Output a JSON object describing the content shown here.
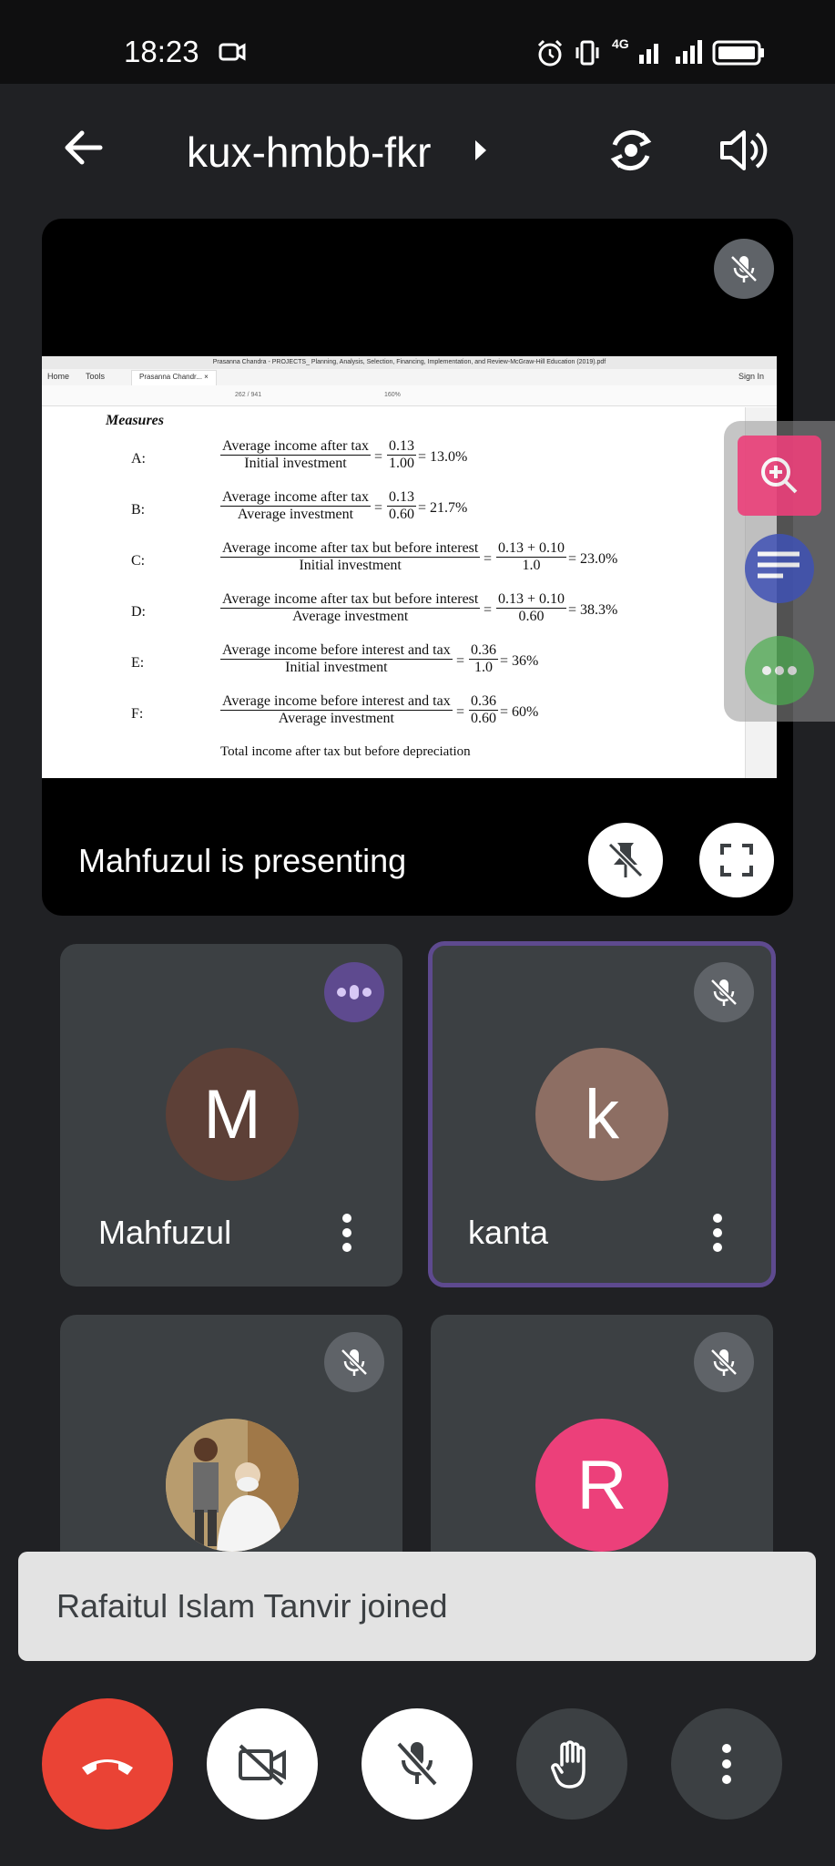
{
  "status_bar": {
    "time": "18:23",
    "network": "4G"
  },
  "header": {
    "meeting_code": "kux-hmbb-fkr",
    "back_icon": "arrow-left-icon",
    "switch_camera_icon": "camera-switch-icon",
    "audio_icon": "volume-icon"
  },
  "presentation": {
    "window_title": "Prasanna Chandra - PROJECTS_ Planning, Analysis, Selection, Financing, Implementation, and Review-McGraw-Hill Education (2019).pdf",
    "tabs": [
      "Home",
      "Tools",
      "Prasanna Chandr... ×"
    ],
    "sign_in": "Sign In",
    "page_indicator": "262 / 941",
    "zoom": "160%",
    "heading": "Measures",
    "rows": [
      {
        "letter": "A:",
        "num": "Average income after tax",
        "den": "Initial investment",
        "fnum": "0.13",
        "fden": "1.00",
        "result": "= 13.0%"
      },
      {
        "letter": "B:",
        "num": "Average income after tax",
        "den": "Average investment",
        "fnum": "0.13",
        "fden": "0.60",
        "result": "= 21.7%"
      },
      {
        "letter": "C:",
        "num": "Average income after tax but before interest",
        "den": "Initial investment",
        "fnum": "0.13 + 0.10",
        "fden": "1.0",
        "result": "= 23.0%"
      },
      {
        "letter": "D:",
        "num": "Average income after tax but before interest",
        "den": "Average investment",
        "fnum": "0.13 + 0.10",
        "fden": "0.60",
        "result": "= 38.3%"
      },
      {
        "letter": "E:",
        "num": "Average income before interest and tax",
        "den": "Initial investment",
        "fnum": "0.36",
        "fden": "1.0",
        "result": "= 36%"
      },
      {
        "letter": "F:",
        "num": "Average income before interest and tax",
        "den": "Average investment",
        "fnum": "0.36",
        "fden": "0.60",
        "result": "= 60%"
      }
    ],
    "footer_line": "Total income after tax but before depreciation",
    "presenting_label": "Mahfuzul is presenting"
  },
  "participants": [
    {
      "name": "Mahfuzul",
      "initial": "M",
      "avatar_color": "#5d4037",
      "status": "speaking"
    },
    {
      "name": "kanta",
      "initial": "k",
      "avatar_color": "#8d6e63",
      "status": "muted",
      "highlighted": true
    },
    {
      "name": "",
      "initial": "",
      "avatar_color": "#b0a080",
      "status": "muted",
      "photo": true
    },
    {
      "name": "",
      "initial": "R",
      "avatar_color": "#ec407a",
      "status": "muted"
    }
  ],
  "toast": {
    "message": "Rafaitul Islam Tanvir joined"
  },
  "controls": {
    "end_call_color": "#ea4335",
    "accent": "#5e4a8f"
  }
}
